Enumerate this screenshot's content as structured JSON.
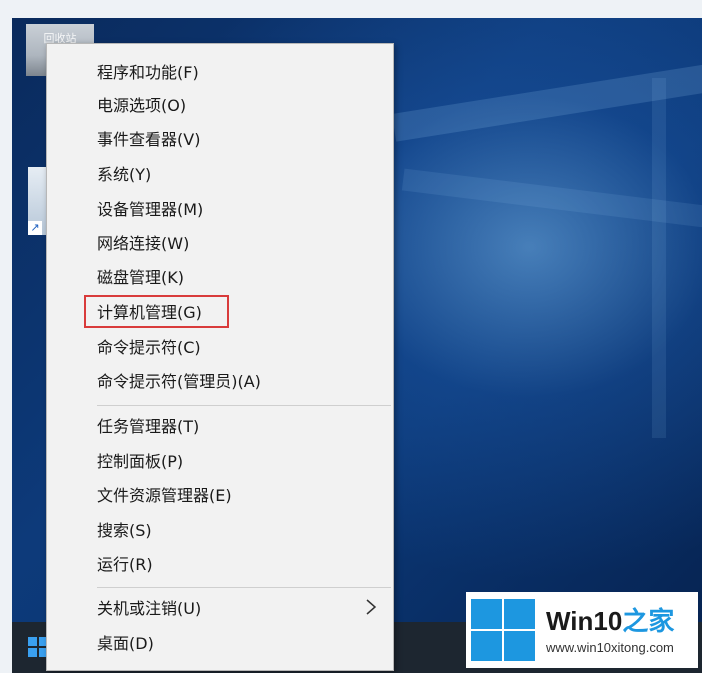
{
  "context_menu": {
    "items": [
      {
        "label": "程序和功能(F)"
      },
      {
        "label": "电源选项(O)"
      },
      {
        "label": "事件查看器(V)"
      },
      {
        "label": "系统(Y)"
      },
      {
        "label": "设备管理器(M)"
      },
      {
        "label": "网络连接(W)"
      },
      {
        "label": "磁盘管理(K)"
      },
      {
        "label": "计算机管理(G)",
        "highlighted": true
      },
      {
        "label": "命令提示符(C)"
      },
      {
        "label": "命令提示符(管理员)(A)"
      },
      {
        "label": "任务管理器(T)"
      },
      {
        "label": "控制面板(P)"
      },
      {
        "label": "文件资源管理器(E)"
      },
      {
        "label": "搜索(S)"
      },
      {
        "label": "运行(R)"
      },
      {
        "label": "关机或注销(U)",
        "has_submenu": true
      },
      {
        "label": "桌面(D)"
      }
    ]
  },
  "desktop": {
    "top_icon_label": "回收站"
  },
  "watermark": {
    "brand": "Win10",
    "suffix": "之家",
    "url": "www.win10xitong.com"
  },
  "colors": {
    "highlight_border": "#d93b3b",
    "windows_blue": "#1d97e0",
    "menu_background": "#f2f2f2",
    "taskbar": "#1d2630"
  },
  "icons": {
    "start": "windows-start-icon",
    "submenu": "chevron-right-icon",
    "shortcut": "shortcut-arrow-icon",
    "watermark_logo": "windows-logo-icon"
  }
}
